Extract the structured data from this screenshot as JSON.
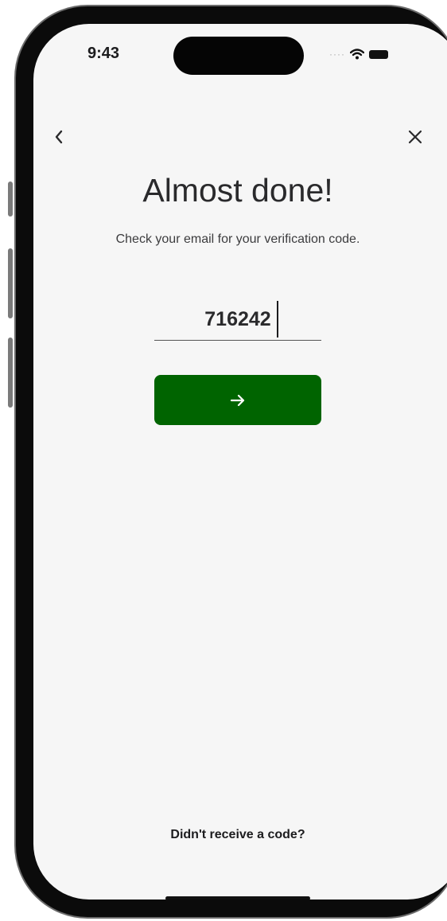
{
  "status_bar": {
    "time": "9:43",
    "icons": [
      "cellular-dots-icon",
      "wifi-icon",
      "battery-icon"
    ]
  },
  "nav": {
    "back_icon": "chevron-left-icon",
    "close_icon": "close-icon"
  },
  "content": {
    "title": "Almost done!",
    "subtitle": "Check your email for your verification code.",
    "code_value": "716242",
    "submit_icon": "arrow-right-icon",
    "resend_link": "Didn't receive a code?"
  },
  "colors": {
    "primary_button": "#006400",
    "background": "#f6f6f6",
    "text": "#2a2a2c"
  }
}
